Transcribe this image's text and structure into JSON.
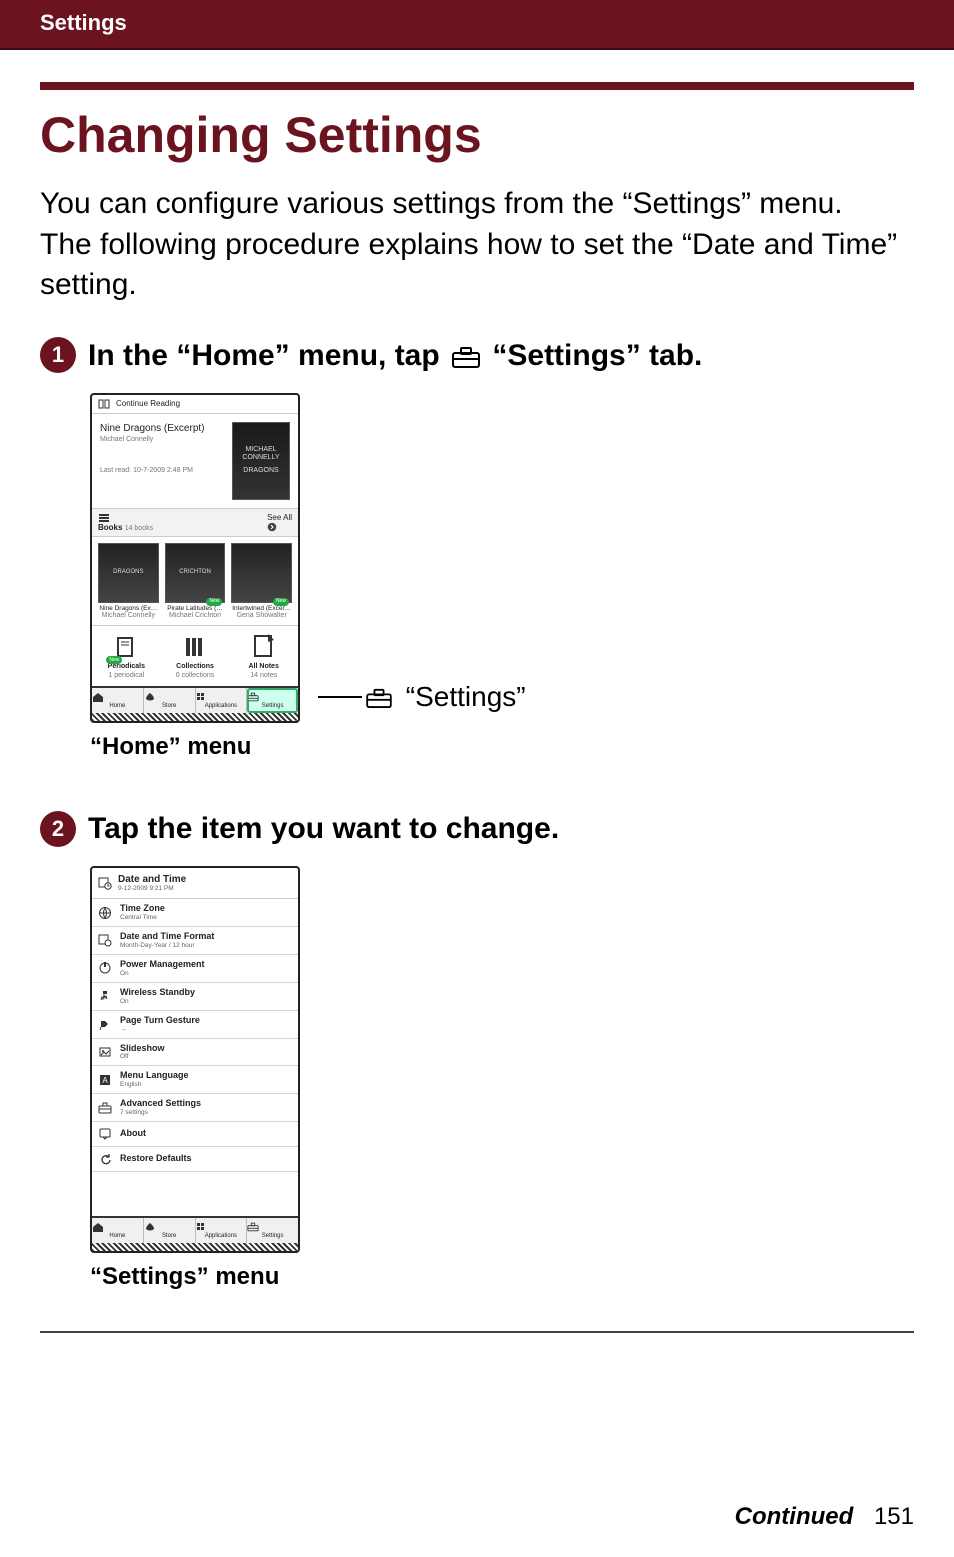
{
  "header": {
    "section_label": "Settings"
  },
  "title": "Changing Settings",
  "intro": "You can configure various settings from the “Settings” menu.\nThe following procedure explains how to set the “Date and Time” setting.",
  "steps": {
    "s1": {
      "num": "1",
      "text_before": "In the “Home” menu, tap ",
      "text_after": " “Settings” tab.",
      "figure_caption": "“Home” menu",
      "callout_label": "“Settings”"
    },
    "s2": {
      "num": "2",
      "text": "Tap the item you want to change.",
      "figure_caption": "“Settings” menu"
    }
  },
  "home_mock": {
    "continue_reading_label": "Continue Reading",
    "book_title": "Nine Dragons (Excerpt)",
    "book_author": "Michael Connelly",
    "last_read": "Last read: 10-7-2009 2:48 PM",
    "cover_line1": "MICHAEL",
    "cover_line2": "CONNELLY",
    "cover_line3": "DRAGONS",
    "books_header": "Books",
    "books_sub": "14 books",
    "see_all": "See All",
    "thumbs": [
      {
        "label": "Nine Dragons (Ex…",
        "author": "Michael Connelly",
        "cover": "DRAGONS"
      },
      {
        "label": "Pirate Latitudes (…",
        "author": "Michael Crichton",
        "cover": "CRICHTON",
        "new": "New"
      },
      {
        "label": "Intertwined (Excer…",
        "author": "Gena Showalter",
        "cover": "",
        "new": "New"
      }
    ],
    "tiles": [
      {
        "label": "Periodicals",
        "sub": "1 periodical",
        "new": "New"
      },
      {
        "label": "Collections",
        "sub": "0 collections"
      },
      {
        "label": "All Notes",
        "sub": "14 notes"
      }
    ],
    "nav": [
      {
        "label": "Home"
      },
      {
        "label": "Store"
      },
      {
        "label": "Applications"
      },
      {
        "label": "Settings",
        "selected": true
      }
    ]
  },
  "settings_mock": {
    "title": "Date and Time",
    "subtitle": "9-12-2009 9:21 PM",
    "items": [
      {
        "t": "Time Zone",
        "s": "Central Time"
      },
      {
        "t": "Date and Time Format",
        "s": "Month-Day-Year / 12 hour"
      },
      {
        "t": "Power Management",
        "s": "On"
      },
      {
        "t": "Wireless Standby",
        "s": "On"
      },
      {
        "t": "Page Turn Gesture",
        "s": "→"
      },
      {
        "t": "Slideshow",
        "s": "Off"
      },
      {
        "t": "Menu Language",
        "s": "English"
      },
      {
        "t": "Advanced Settings",
        "s": "7 settings"
      },
      {
        "t": "About",
        "s": ""
      },
      {
        "t": "Restore Defaults",
        "s": ""
      }
    ],
    "nav": [
      {
        "label": "Home"
      },
      {
        "label": "Store"
      },
      {
        "label": "Applications"
      },
      {
        "label": "Settings"
      }
    ]
  },
  "footer": {
    "continued": "Continued",
    "page": "151"
  }
}
